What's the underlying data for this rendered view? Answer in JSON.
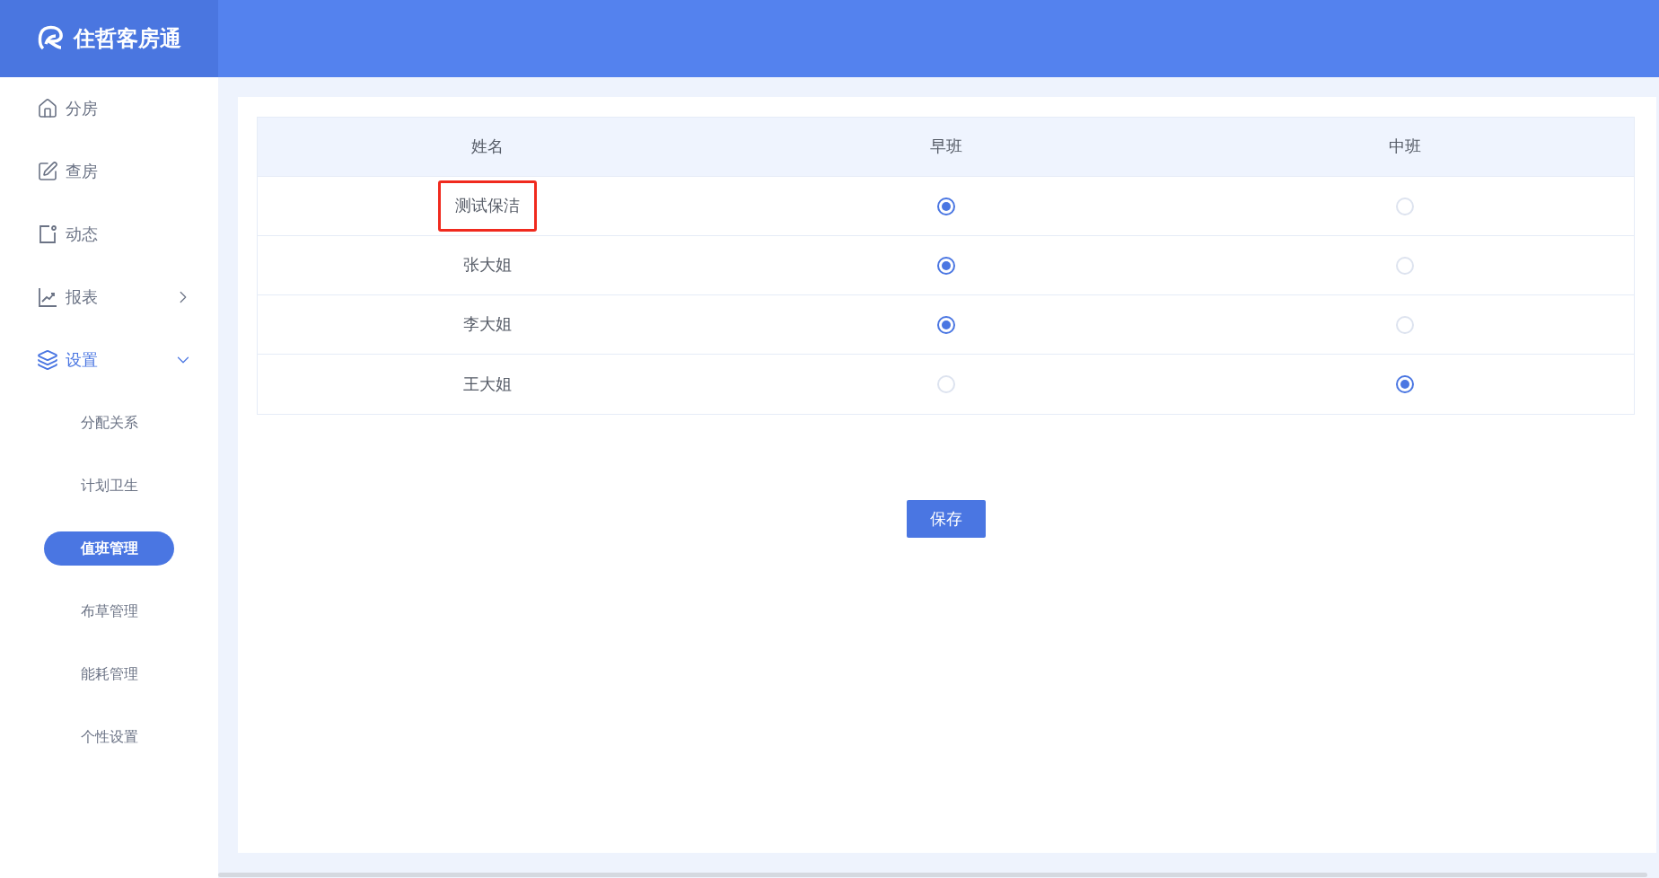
{
  "brand": {
    "title": "住哲客房通"
  },
  "sidebar": {
    "items": [
      {
        "label": "分房",
        "selected": false
      },
      {
        "label": "查房",
        "selected": false
      },
      {
        "label": "动态",
        "selected": false
      },
      {
        "label": "报表",
        "selected": false,
        "expanded": false
      },
      {
        "label": "设置",
        "selected": true,
        "expanded": true,
        "children": [
          {
            "label": "分配关系",
            "selected": false
          },
          {
            "label": "计划卫生",
            "selected": false
          },
          {
            "label": "值班管理",
            "selected": true
          },
          {
            "label": "布草管理",
            "selected": false
          },
          {
            "label": "能耗管理",
            "selected": false
          },
          {
            "label": "个性设置",
            "selected": false
          }
        ]
      }
    ]
  },
  "table": {
    "columns": [
      "姓名",
      "早班",
      "中班"
    ],
    "rows": [
      {
        "name": "测试保洁",
        "highlighted": true,
        "shifts": [
          {
            "selected": true
          },
          {
            "selected": false
          }
        ]
      },
      {
        "name": "张大姐",
        "highlighted": false,
        "shifts": [
          {
            "selected": true
          },
          {
            "selected": false
          }
        ]
      },
      {
        "name": "李大姐",
        "highlighted": false,
        "shifts": [
          {
            "selected": true
          },
          {
            "selected": false
          }
        ]
      },
      {
        "name": "王大姐",
        "highlighted": false,
        "shifts": [
          {
            "selected": false
          },
          {
            "selected": true
          }
        ]
      }
    ]
  },
  "save_button": "保存"
}
